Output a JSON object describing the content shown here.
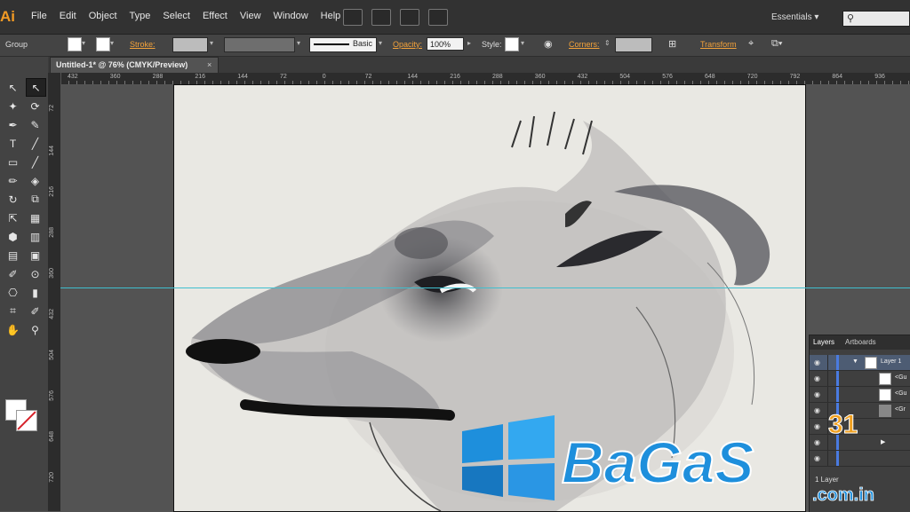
{
  "app": {
    "logo": "Ai"
  },
  "menubar": {
    "items": [
      "File",
      "Edit",
      "Object",
      "Type",
      "Select",
      "Effect",
      "View",
      "Window",
      "Help"
    ],
    "workspace": "Essentials",
    "search_icon": "⚲"
  },
  "control": {
    "selection": "Group",
    "stroke_label": "Stroke:",
    "brush": "Basic",
    "opacity_label": "Opacity:",
    "opacity_value": "100%",
    "style_label": "Style:",
    "corners_label": "Corners:",
    "transform_label": "Transform"
  },
  "document": {
    "tab_title": "Untitled-1* @ 76% (CMYK/Preview)",
    "close": "×"
  },
  "rulers": {
    "h_labels": [
      "432",
      "360",
      "288",
      "216",
      "144",
      "72",
      "0",
      "72",
      "144",
      "216",
      "288",
      "360",
      "432",
      "504",
      "576",
      "648",
      "720",
      "792",
      "864",
      "936"
    ],
    "v_labels": [
      "72",
      "144",
      "216",
      "288",
      "360",
      "432",
      "504",
      "576",
      "648",
      "720"
    ]
  },
  "tools": [
    [
      "↖",
      "↖"
    ],
    [
      "✦",
      "⟳"
    ],
    [
      "✒",
      "✎"
    ],
    [
      "T",
      "╱"
    ],
    [
      "▭",
      "╱"
    ],
    [
      "✏",
      "◈"
    ],
    [
      "↻",
      "⧉"
    ],
    [
      "⇱",
      "▦"
    ],
    [
      "⬢",
      "▥"
    ],
    [
      "▤",
      "▣"
    ],
    [
      "✐",
      "⊙"
    ],
    [
      "⎔",
      "▮"
    ],
    [
      "⌗",
      "✐"
    ],
    [
      "✋",
      "⚲"
    ]
  ],
  "layers_panel": {
    "tabs": [
      "Layers",
      "Artboards"
    ],
    "rows": [
      "Layer 1",
      "<Gu",
      "<Gu",
      "<Gr"
    ],
    "footer": "1 Layer"
  },
  "watermark": {
    "text": "BaGaS",
    "num": "31",
    "domain": ".com.in"
  },
  "colors": {
    "accent": "#f3a23a",
    "guide": "#3fbfcf",
    "watermark": "#1e8fdc"
  }
}
